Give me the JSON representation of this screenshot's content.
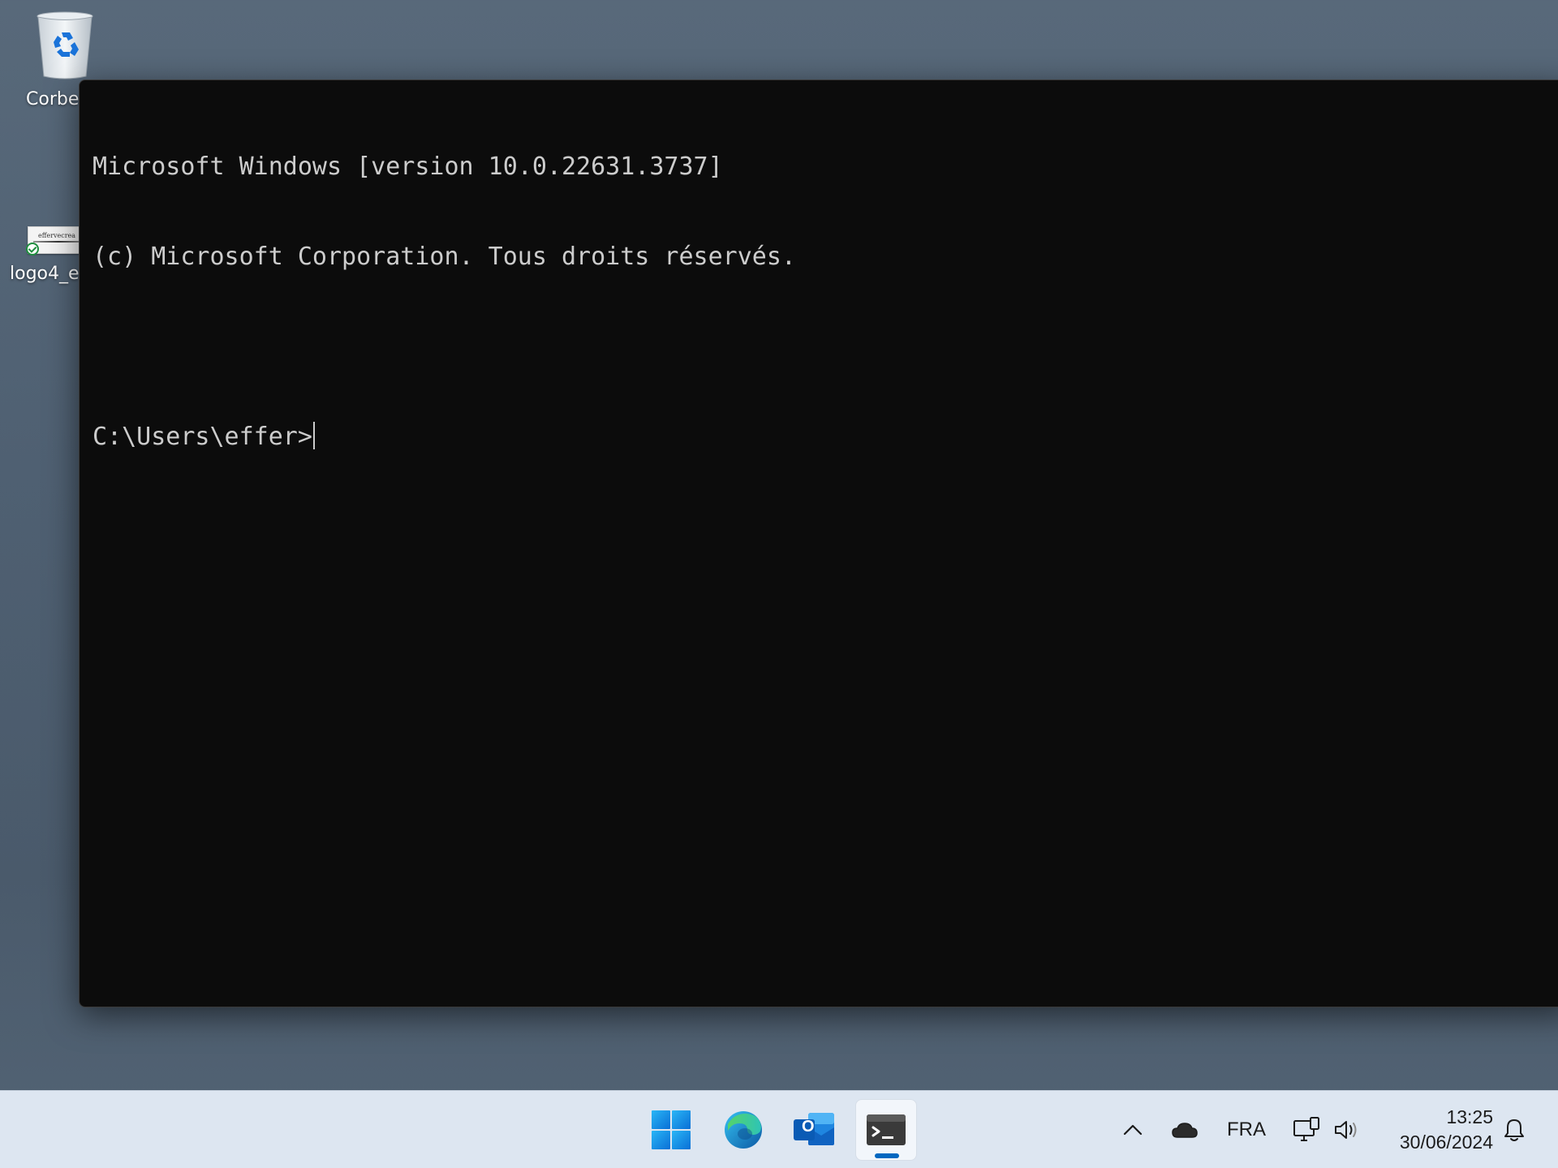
{
  "desktop": {
    "icons": [
      {
        "label": "Corbe",
        "icon": "recycle-bin-icon"
      },
      {
        "label": "logo4_e",
        "icon": "image-file-icon",
        "thumbnail_text": "effervecrea"
      }
    ]
  },
  "terminal": {
    "lines": [
      "Microsoft Windows [version 10.0.22631.3737]",
      "(c) Microsoft Corporation. Tous droits réservés.",
      "",
      "C:\\Users\\effer>"
    ],
    "background": "#0c0c0c",
    "foreground": "#cccccc"
  },
  "taskbar": {
    "apps": [
      {
        "name": "start",
        "icon": "windows-logo-icon"
      },
      {
        "name": "edge",
        "icon": "edge-browser-icon"
      },
      {
        "name": "outlook",
        "icon": "outlook-icon",
        "letter": "O"
      },
      {
        "name": "terminal",
        "icon": "terminal-icon",
        "active": true
      }
    ],
    "tray": {
      "chevron_icon": "chevron-up-icon",
      "cloud_icon": "onedrive-cloud-icon",
      "language": "FRA",
      "network_icon": "network-icon",
      "volume_icon": "volume-icon",
      "time": "13:25",
      "date": "30/06/2024",
      "notification_icon": "bell-icon"
    },
    "accent": "#0067c0"
  }
}
